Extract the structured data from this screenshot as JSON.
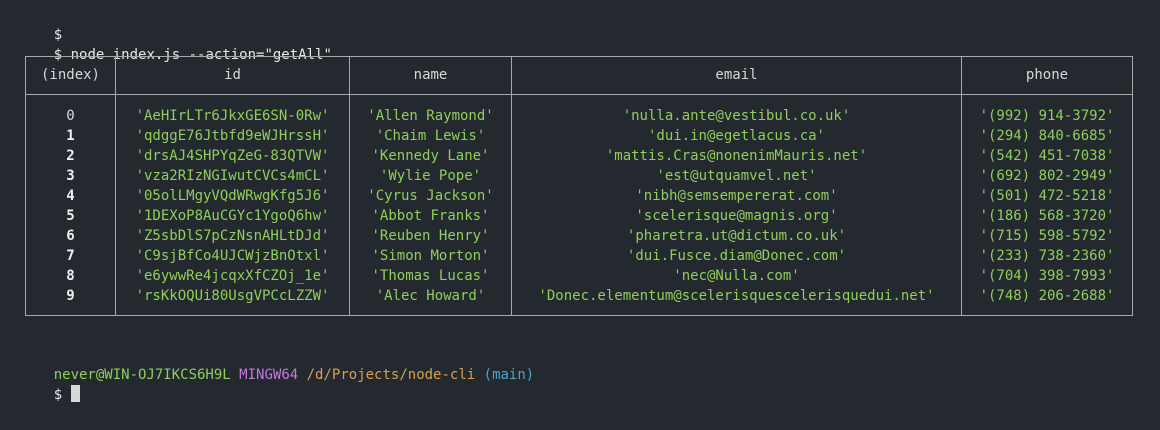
{
  "terminal": {
    "line1_prompt": "$",
    "line2_prompt": "$",
    "command": "node index.js --action=\"getAll\""
  },
  "table": {
    "headers": [
      "(index)",
      "id",
      "name",
      "email",
      "phone"
    ],
    "rows": [
      [
        "0",
        "'AeHIrLTr6JkxGE6SN-0Rw'",
        "'Allen Raymond'",
        "'nulla.ante@vestibul.co.uk'",
        "'(992) 914-3792'"
      ],
      [
        "1",
        "'qdggE76Jtbfd9eWJHrssH'",
        "'Chaim Lewis'",
        "'dui.in@egetlacus.ca'",
        "'(294) 840-6685'"
      ],
      [
        "2",
        "'drsAJ4SHPYqZeG-83QTVW'",
        "'Kennedy Lane'",
        "'mattis.Cras@nonenimMauris.net'",
        "'(542) 451-7038'"
      ],
      [
        "3",
        "'vza2RIzNGIwutCVCs4mCL'",
        "'Wylie Pope'",
        "'est@utquamvel.net'",
        "'(692) 802-2949'"
      ],
      [
        "4",
        "'05olLMgyVQdWRwgKfg5J6'",
        "'Cyrus Jackson'",
        "'nibh@semsempererat.com'",
        "'(501) 472-5218'"
      ],
      [
        "5",
        "'1DEXoP8AuCGYc1YgoQ6hw'",
        "'Abbot Franks'",
        "'scelerisque@magnis.org'",
        "'(186) 568-3720'"
      ],
      [
        "6",
        "'Z5sbDlS7pCzNsnAHLtDJd'",
        "'Reuben Henry'",
        "'pharetra.ut@dictum.co.uk'",
        "'(715) 598-5792'"
      ],
      [
        "7",
        "'C9sjBfCo4UJCWjzBnOtxl'",
        "'Simon Morton'",
        "'dui.Fusce.diam@Donec.com'",
        "'(233) 738-2360'"
      ],
      [
        "8",
        "'e6ywwRe4jcqxXfCZOj_1e'",
        "'Thomas Lucas'",
        "'nec@Nulla.com'",
        "'(704) 398-7993'"
      ],
      [
        "9",
        "'rsKkOQUi80UsgVPCcLZZW'",
        "'Alec Howard'",
        "'Donec.elementum@scelerisquescelerisquedui.net'",
        "'(748) 206-2688'"
      ]
    ]
  },
  "prompt": {
    "user_host": "never@WIN-OJ7IKCS6H9L",
    "shell": "MINGW64",
    "path": "/d/Projects/node-cli",
    "branch": "(main)",
    "input_prompt": "$"
  }
}
